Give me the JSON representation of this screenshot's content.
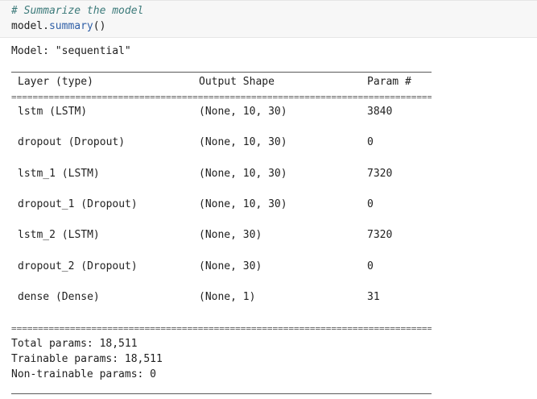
{
  "input": {
    "comment": "# Summarize the model",
    "code_object": "model.",
    "code_method": "summary",
    "code_parens": "()"
  },
  "output": {
    "model_line": "Model: \"sequential\"",
    "headers": {
      "layer": "Layer (type)",
      "shape": "Output Shape",
      "params": "Param #"
    },
    "separator": "==========================================================================================",
    "rows": [
      {
        "layer": "lstm (LSTM)",
        "shape": "(None, 10, 30)",
        "params": "3840"
      },
      {
        "layer": "dropout (Dropout)",
        "shape": "(None, 10, 30)",
        "params": "0"
      },
      {
        "layer": "lstm_1 (LSTM)",
        "shape": "(None, 10, 30)",
        "params": "7320"
      },
      {
        "layer": "dropout_1 (Dropout)",
        "shape": "(None, 10, 30)",
        "params": "0"
      },
      {
        "layer": "lstm_2 (LSTM)",
        "shape": "(None, 30)",
        "params": "7320"
      },
      {
        "layer": "dropout_2 (Dropout)",
        "shape": "(None, 30)",
        "params": "0"
      },
      {
        "layer": "dense (Dense)",
        "shape": "(None, 1)",
        "params": "31"
      }
    ],
    "totals": {
      "total": "Total params: 18,511",
      "trainable": "Trainable params: 18,511",
      "non_trainable": "Non-trainable params: 0"
    }
  }
}
